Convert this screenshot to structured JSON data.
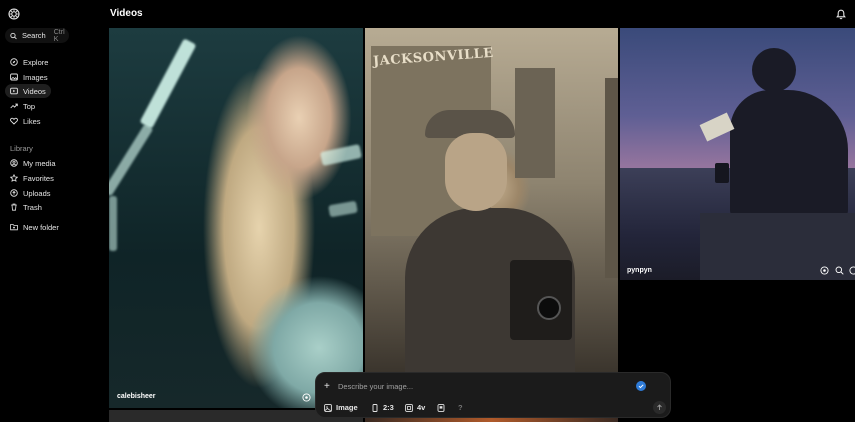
{
  "header": {
    "title": "Videos"
  },
  "sidebar": {
    "search": {
      "label": "Search",
      "shortcut": "Ctrl K"
    },
    "items": [
      {
        "label": "Explore",
        "icon": "compass-icon"
      },
      {
        "label": "Images",
        "icon": "image-icon"
      },
      {
        "label": "Videos",
        "icon": "video-icon",
        "active": true
      },
      {
        "label": "Top",
        "icon": "trending-up-icon"
      },
      {
        "label": "Likes",
        "icon": "heart-icon"
      }
    ],
    "library_label": "Library",
    "library_items": [
      {
        "label": "My media",
        "icon": "user-icon"
      },
      {
        "label": "Favorites",
        "icon": "star-icon"
      },
      {
        "label": "Uploads",
        "icon": "upload-icon"
      },
      {
        "label": "Trash",
        "icon": "trash-icon"
      }
    ],
    "new_folder": "New folder"
  },
  "cards": [
    {
      "author": "calebisheer"
    },
    {
      "sign_text": "JACKSONVILLE"
    },
    {
      "author": "pynpyn"
    }
  ],
  "prompt": {
    "placeholder": "Describe your image...",
    "mode": "Image",
    "ratio": "2:3",
    "count": "4v",
    "help": "?"
  },
  "colors": {
    "accent": "#2e7bd8",
    "background": "#000000"
  }
}
